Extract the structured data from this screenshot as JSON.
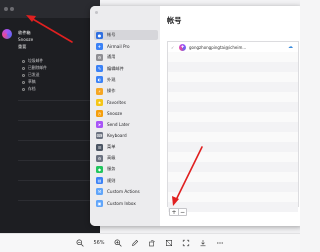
{
  "mail_app": {
    "nav": [
      "收件箱",
      "Snooze",
      "重要"
    ],
    "folders": [
      "垃圾邮件",
      "已删除邮件",
      "已发送",
      "草稿",
      "存档"
    ]
  },
  "settings": {
    "title": "帐号",
    "sidebar": [
      {
        "label": "帐号",
        "color": "#2f6fe0",
        "glyph": "●"
      },
      {
        "label": "Airmail Pro",
        "color": "#3b82f6",
        "glyph": "✈"
      },
      {
        "label": "通用",
        "color": "#8e8e93",
        "glyph": "⚙"
      },
      {
        "label": "编辑邮件",
        "color": "#3b82f6",
        "glyph": "✎"
      },
      {
        "label": "外观",
        "color": "#3b82f6",
        "glyph": "◐"
      },
      {
        "label": "操作",
        "color": "#f5a623",
        "glyph": "⚡"
      },
      {
        "label": "Favorites",
        "color": "#f5c518",
        "glyph": "★"
      },
      {
        "label": "Snooze",
        "color": "#f59e0b",
        "glyph": "◷"
      },
      {
        "label": "Send Later",
        "color": "#a855f7",
        "glyph": "➤"
      },
      {
        "label": "Keyboard",
        "color": "#6b7280",
        "glyph": "⌨"
      },
      {
        "label": "菜单",
        "color": "#4b5563",
        "glyph": "☰"
      },
      {
        "label": "高级",
        "color": "#6b7280",
        "glyph": "⚙"
      },
      {
        "label": "服务",
        "color": "#22c55e",
        "glyph": "◆"
      },
      {
        "label": "规则",
        "color": "#3b82f6",
        "glyph": "▤"
      },
      {
        "label": "Custom Actions",
        "color": "#60a5fa",
        "glyph": "⚒"
      },
      {
        "label": "Custom Inbox",
        "color": "#60a5fa",
        "glyph": "▣"
      }
    ],
    "account": {
      "email": "gongzhongping",
      "email_display": "gongzhongpingtai@icheim..."
    },
    "add_label": "+",
    "remove_label": "−"
  },
  "toolbar": {
    "zoom": "56%"
  }
}
